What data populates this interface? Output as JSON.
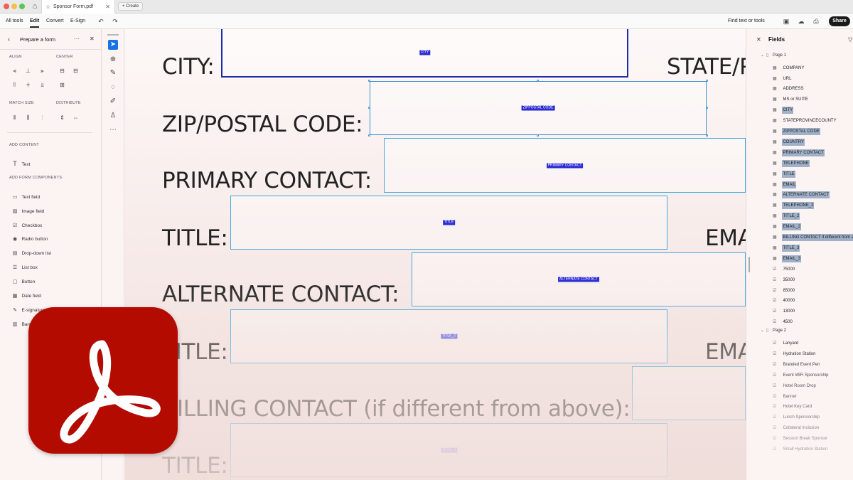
{
  "titlebar": {
    "tab_title": "Sponsor Form.pdf",
    "create_label": "Create"
  },
  "menubar": {
    "items": [
      "All tools",
      "Edit",
      "Convert",
      "E-Sign"
    ],
    "active_index": 1,
    "find_label": "Find text or tools",
    "share_label": "Share"
  },
  "left_panel": {
    "title": "Prepare a form",
    "align_label": "ALIGN",
    "center_label": "CENTER",
    "match_size_label": "MATCH SIZE",
    "distribute_label": "DISTRIBUTE",
    "add_content_label": "ADD CONTENT",
    "text_label": "Text",
    "add_form_components_label": "ADD FORM COMPONENTS",
    "components": [
      "Text field",
      "Image field",
      "Checkbox",
      "Radio button",
      "Drop-down list",
      "List box",
      "Button",
      "Date field",
      "E-signature field",
      "Barcode"
    ]
  },
  "document": {
    "labels": {
      "city": "CITY:",
      "state": "STATE/P",
      "zip": "ZIP/POSTAL CODE:",
      "primary": "PRIMARY CONTACT:",
      "title1": "TITLE:",
      "email1": "EMA",
      "alternate": "ALTERNATE CONTACT:",
      "title2": "TITLE:",
      "email2": "EMA",
      "billing": "BILLING CONTACT (if different from above):",
      "title3": "TITLE:"
    },
    "field_tags": {
      "city": "CITY",
      "zip": "ZIPPOSTAL CODE",
      "primary": "PRIMARY CONTACT",
      "title1": "TITLE",
      "alternate": "ALTERNATE CONTACT",
      "title2": "TITLE_2",
      "title3": "TITLE_3"
    }
  },
  "fields_panel": {
    "title": "Fields",
    "page1_label": "Page 1",
    "page1_fields": [
      {
        "name": "COMPANY",
        "type": "text",
        "highlighted": false
      },
      {
        "name": "URL",
        "type": "text",
        "highlighted": false
      },
      {
        "name": "ADDRESS",
        "type": "text",
        "highlighted": false
      },
      {
        "name": "MS or SUITE",
        "type": "text",
        "highlighted": false
      },
      {
        "name": "CITY",
        "type": "text",
        "highlighted": true
      },
      {
        "name": "STATEPROVINCECOUNTY",
        "type": "text",
        "highlighted": false
      },
      {
        "name": "ZIPPOSTAL CODE",
        "type": "text",
        "highlighted": true
      },
      {
        "name": "COUNTRY",
        "type": "text",
        "highlighted": true
      },
      {
        "name": "PRIMARY CONTACT",
        "type": "text",
        "highlighted": true
      },
      {
        "name": "TELEPHONE",
        "type": "text",
        "highlighted": true
      },
      {
        "name": "TITLE",
        "type": "text",
        "highlighted": true
      },
      {
        "name": "EMAIL",
        "type": "text",
        "highlighted": true
      },
      {
        "name": "ALTERNATE CONTACT",
        "type": "text",
        "highlighted": true
      },
      {
        "name": "TELEPHONE_2",
        "type": "text",
        "highlighted": true
      },
      {
        "name": "TITLE_2",
        "type": "text",
        "highlighted": true
      },
      {
        "name": "EMAIL_2",
        "type": "text",
        "highlighted": true
      },
      {
        "name": "BILLING CONTACT if different from a",
        "type": "text",
        "highlighted": true
      },
      {
        "name": "TITLE_3",
        "type": "text",
        "highlighted": true
      },
      {
        "name": "EMAIL_3",
        "type": "text",
        "highlighted": true
      },
      {
        "name": "75000",
        "type": "checkbox",
        "highlighted": false
      },
      {
        "name": "35000",
        "type": "checkbox",
        "highlighted": false
      },
      {
        "name": "85000",
        "type": "checkbox",
        "highlighted": false
      },
      {
        "name": "40000",
        "type": "checkbox",
        "highlighted": false
      },
      {
        "name": "13000",
        "type": "checkbox",
        "highlighted": false
      },
      {
        "name": "4500",
        "type": "checkbox",
        "highlighted": false
      }
    ],
    "page2_label": "Page 2",
    "page2_fields": [
      {
        "name": "Lanyard",
        "type": "checkbox"
      },
      {
        "name": "Hydration Station",
        "type": "checkbox"
      },
      {
        "name": "Branded Event Pen",
        "type": "checkbox"
      },
      {
        "name": "Event WiFi Sponsorship",
        "type": "checkbox"
      },
      {
        "name": "Hotel Room Drop",
        "type": "checkbox"
      },
      {
        "name": "Banner",
        "type": "checkbox"
      },
      {
        "name": "Hotel Key Card",
        "type": "checkbox"
      },
      {
        "name": "Lunch Sponsorship",
        "type": "checkbox"
      },
      {
        "name": "Collateral Inclusion",
        "type": "checkbox"
      },
      {
        "name": "Session Break Sponsor",
        "type": "checkbox"
      },
      {
        "name": "Small Hydration Station",
        "type": "checkbox"
      }
    ]
  },
  "colors": {
    "acrobat_red": "#b30b00",
    "selection_blue": "#1473e6",
    "field_highlight": "#9fb0c8",
    "field_tag": "#2b2bd4"
  }
}
